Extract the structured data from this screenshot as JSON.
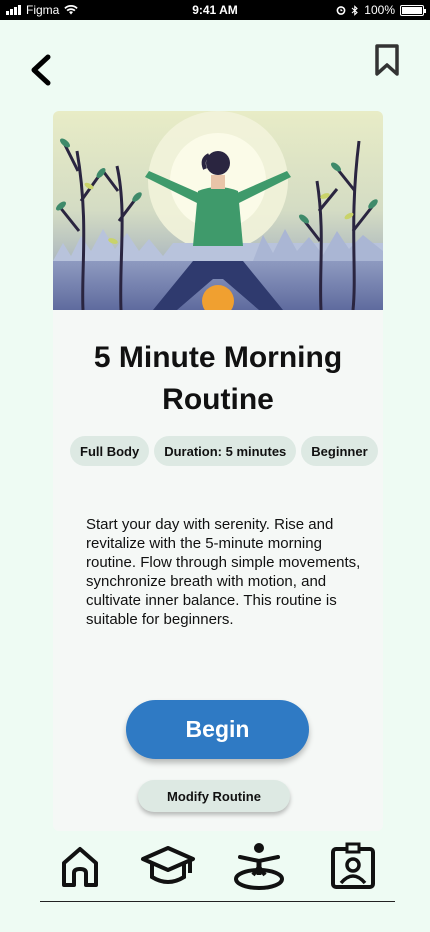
{
  "status_bar": {
    "carrier": "Figma",
    "time": "9:41 AM",
    "battery": "100%",
    "battery_level": 1.0
  },
  "header": {
    "back_icon": "chevron-left-icon",
    "bookmark_icon": "bookmark-icon"
  },
  "routine": {
    "title": "5 Minute Morning Routine",
    "tags": [
      "Full Body",
      "Duration: 5 minutes",
      "Beginner"
    ],
    "description": "Start your day with serenity. Rise and revitalize with the 5-minute morning routine. Flow through simple movements, synchronize breath with motion, and cultivate inner balance. This routine is suitable for beginners.",
    "begin_label": "Begin",
    "modify_label": "Modify Routine"
  },
  "nav": {
    "items": [
      "home-icon",
      "graduation-cap-icon",
      "meditation-person-icon",
      "profile-badge-icon"
    ]
  },
  "colors": {
    "background": "#eefbf3",
    "accent": "#2f7ac4",
    "chip": "#dde9e3",
    "card": "#f5f8f6"
  }
}
